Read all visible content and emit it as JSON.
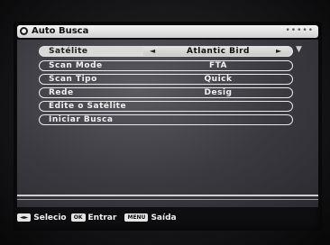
{
  "header": {
    "title": "Auto Busca",
    "dots": "•••••"
  },
  "menu": {
    "items": [
      {
        "label": "Satélite",
        "value": "Atlantic Bird",
        "left_arrow": "◄",
        "right_arrow": "►"
      },
      {
        "label": "Scan Mode",
        "value": "FTA"
      },
      {
        "label": "Scan Tipo",
        "value": "Quick"
      },
      {
        "label": "Rede",
        "value": "Desig"
      },
      {
        "label": "Edite o Satélite"
      },
      {
        "label": "Iniciar Busca"
      }
    ],
    "scroll_arrow": "▼"
  },
  "footer": {
    "select_key": "◄►",
    "select_label": "Selecio",
    "ok_key": "OK",
    "ok_label": "Entrar",
    "menu_key": "MENU",
    "menu_label": "Saída"
  },
  "colors": {
    "row_border": "#e8e8e8",
    "selected_bg": "#d9d9d9",
    "panel": "#3a3a40"
  }
}
